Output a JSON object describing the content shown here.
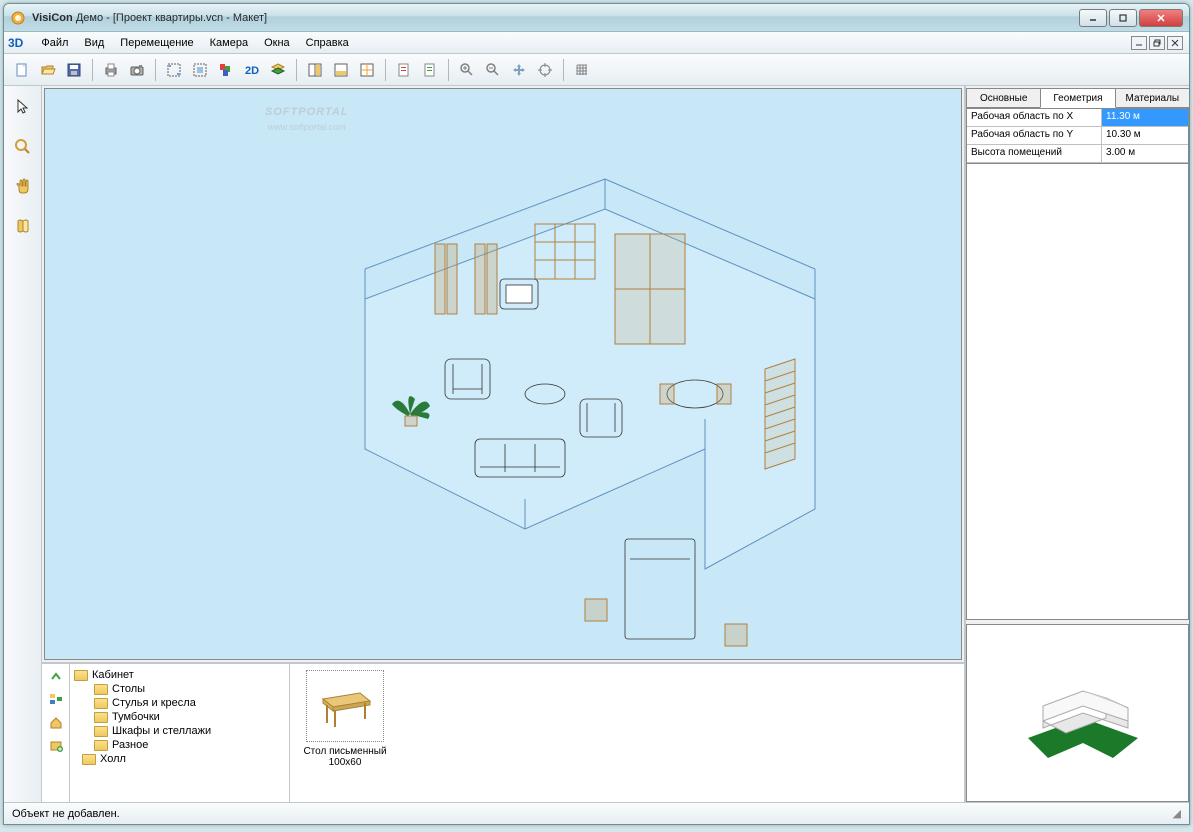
{
  "window": {
    "app_name": "VisiCon",
    "demo_label": "Демо",
    "document": "[Проект квартиры.vcn - Макет]"
  },
  "menu": {
    "logo": "3D",
    "items": [
      "Файл",
      "Вид",
      "Перемещение",
      "Камера",
      "Окна",
      "Справка"
    ]
  },
  "watermark": {
    "main": "SOFTPORTAL",
    "sub": "www.softportal.com"
  },
  "props_panel": {
    "tabs": [
      "Основные",
      "Геометрия",
      "Материалы"
    ],
    "active_tab": 1,
    "rows": [
      {
        "label": "Рабочая область по X",
        "value": "11.30 м",
        "selected": true
      },
      {
        "label": "Рабочая область по Y",
        "value": "10.30 м",
        "selected": false
      },
      {
        "label": "Высота помещений",
        "value": "3.00 м",
        "selected": false
      }
    ]
  },
  "library": {
    "folders": [
      {
        "name": "Кабинет",
        "level": 0
      },
      {
        "name": "Столы",
        "level": 1
      },
      {
        "name": "Стулья и кресла",
        "level": 1
      },
      {
        "name": "Тумбочки",
        "level": 1
      },
      {
        "name": "Шкафы и стеллажи",
        "level": 1
      },
      {
        "name": "Разное",
        "level": 1
      },
      {
        "name": "Холл",
        "level": 0
      }
    ],
    "selected_object": "Стол письменный 100х60"
  },
  "status": {
    "text": "Объект не добавлен."
  }
}
